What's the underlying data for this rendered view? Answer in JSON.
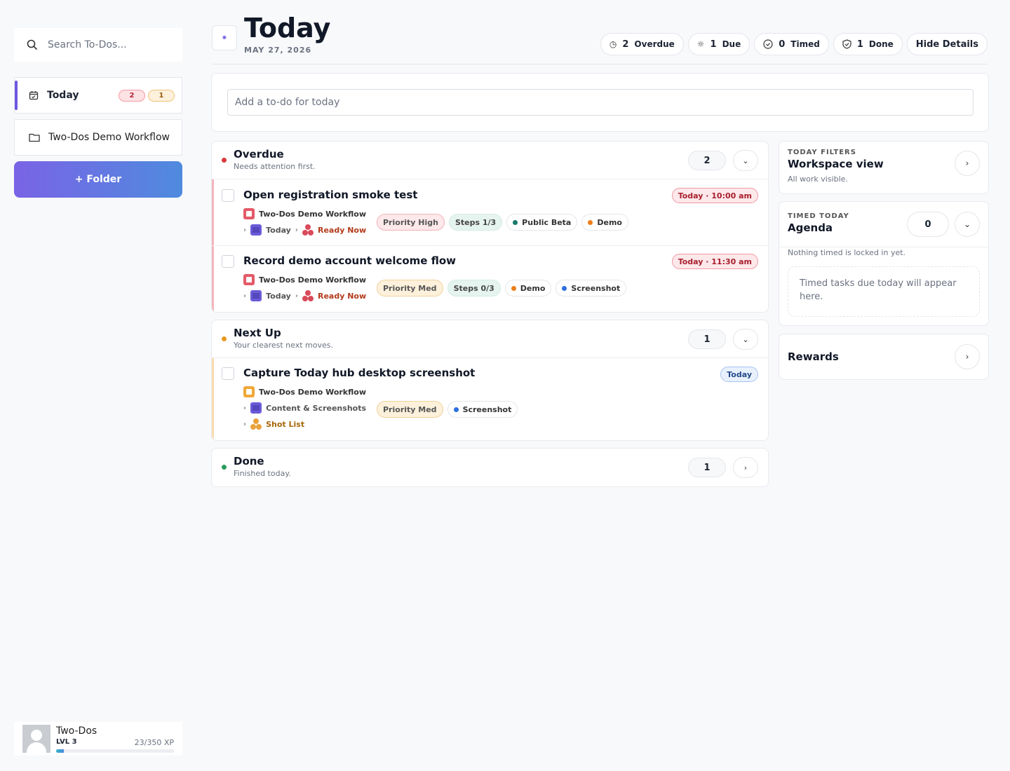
{
  "sidebar": {
    "search_placeholder": "Search To-Dos...",
    "nav": [
      {
        "label": "Today",
        "badges": [
          "2",
          "1"
        ]
      },
      {
        "label": "Two-Dos Demo Workflow"
      }
    ],
    "add_folder_label": "+ Folder"
  },
  "profile": {
    "name": "Two-Dos",
    "level": "LVL 3",
    "xp": "23/350 XP",
    "xp_progress": 0.066
  },
  "header": {
    "title": "Today",
    "date": "MAY 27, 2026",
    "stats": [
      {
        "icon": "alarm-icon",
        "count": "2",
        "label": "Overdue"
      },
      {
        "icon": "sun-icon",
        "count": "1",
        "label": "Due"
      },
      {
        "icon": "clock-icon",
        "count": "0",
        "label": "Timed"
      },
      {
        "icon": "shield-check-icon",
        "count": "1",
        "label": "Done"
      }
    ],
    "hide_details_label": "Hide Details"
  },
  "add_todo": {
    "placeholder": "Add a to-do for today"
  },
  "sections": {
    "overdue": {
      "title": "Overdue",
      "subtitle": "Needs attention first.",
      "count": "2",
      "color": "#d83a3a"
    },
    "next_up": {
      "title": "Next Up",
      "subtitle": "Your clearest next moves.",
      "count": "1",
      "color": "#e69a1e"
    },
    "done": {
      "title": "Done",
      "subtitle": "Finished today.",
      "count": "1",
      "color": "#2a9d5c"
    }
  },
  "tasks": {
    "t1": {
      "title": "Open registration smoke test",
      "due": "Today · 10:00 am",
      "workflow": "Two-Dos Demo Workflow",
      "path_list": "Today",
      "path_status": "Ready Now",
      "priority": "Priority High",
      "steps": "Steps 1/3",
      "tag1": "Public Beta",
      "tag2": "Demo"
    },
    "t2": {
      "title": "Record demo account welcome flow",
      "due": "Today · 11:30 am",
      "workflow": "Two-Dos Demo Workflow",
      "path_list": "Today",
      "path_status": "Ready Now",
      "priority": "Priority Med",
      "steps": "Steps 0/3",
      "tag1": "Demo",
      "tag2": "Screenshot"
    },
    "t3": {
      "title": "Capture Today hub desktop screenshot",
      "due": "Today",
      "workflow": "Two-Dos Demo Workflow",
      "path_list": "Content & Screenshots",
      "path_status": "Shot List",
      "priority": "Priority Med",
      "tag1": "Screenshot"
    }
  },
  "right": {
    "filters": {
      "label": "TODAY FILTERS",
      "title": "Workspace view",
      "subtitle": "All work visible."
    },
    "agenda": {
      "label": "TIMED TODAY",
      "title": "Agenda",
      "count": "0",
      "subtitle": "Nothing timed is locked in yet.",
      "empty": "Timed tasks due today will appear here."
    },
    "rewards": {
      "title": "Rewards"
    }
  },
  "colors": {
    "accent": "#6f56e0",
    "red": "#d83a3a",
    "orange": "#e69a1e",
    "green": "#2a9d5c",
    "teal": "#167a6a",
    "blue": "#2d6fe0",
    "tag_orange": "#ef7d1a"
  }
}
